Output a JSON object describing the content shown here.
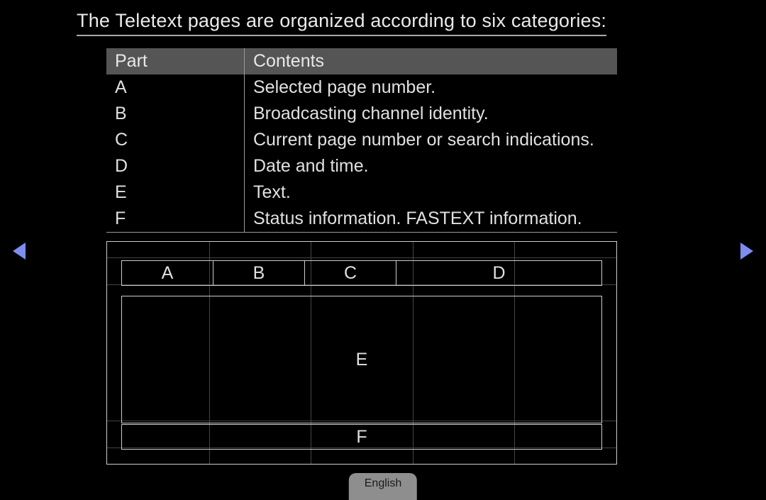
{
  "title": "The Teletext pages are organized according to six categories:",
  "table": {
    "headers": {
      "part": "Part",
      "contents": "Contents"
    },
    "rows": [
      {
        "part": "A",
        "contents": "Selected page number."
      },
      {
        "part": "B",
        "contents": "Broadcasting channel identity."
      },
      {
        "part": "C",
        "contents": "Current page number or search indications."
      },
      {
        "part": "D",
        "contents": "Date and time."
      },
      {
        "part": "E",
        "contents": "Text."
      },
      {
        "part": "F",
        "contents": "Status information. FASTEXT information."
      }
    ]
  },
  "diagram": {
    "a": "A",
    "b": "B",
    "c": "C",
    "d": "D",
    "e": "E",
    "f": "F"
  },
  "language_button": "English"
}
